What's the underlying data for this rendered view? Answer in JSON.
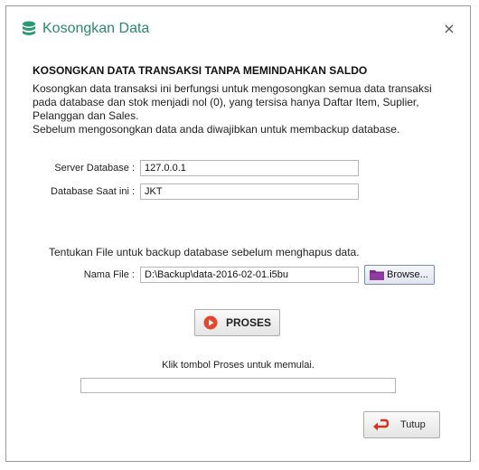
{
  "window": {
    "title": "Kosongkan Data",
    "close_glyph": "×",
    "title_icon": "database-icon",
    "title_color": "#2a8a6a"
  },
  "content": {
    "heading": "KOSONGKAN DATA TRANSAKSI TANPA MEMINDAHKAN SALDO",
    "description_line1": "Kosongkan data transaksi ini berfungsi untuk mengosongkan semua data transaksi pada database dan stok menjadi nol (0), yang tersisa hanya Daftar Item, Suplier, Pelanggan dan Sales.",
    "description_line2": "Sebelum mengosongkan data anda diwajibkan untuk membackup database."
  },
  "form": {
    "server_label": "Server Database :",
    "server_value": "127.0.0.1",
    "db_label": "Database Saat ini :",
    "db_value": "JKT",
    "backup_hint": "Tentukan File untuk backup database sebelum menghapus data.",
    "file_label": "Nama File :",
    "file_value": "D:\\Backup\\data-2016-02-01.i5bu",
    "browse_label": "Browse...",
    "browse_icon": "folder-icon"
  },
  "actions": {
    "proses_label": "PROSES",
    "proses_icon": "play-icon",
    "status_text": "Klik tombol Proses untuk memulai.",
    "progress_percent": 0,
    "tutup_label": "Tutup",
    "tutup_icon": "return-arrow-icon"
  }
}
